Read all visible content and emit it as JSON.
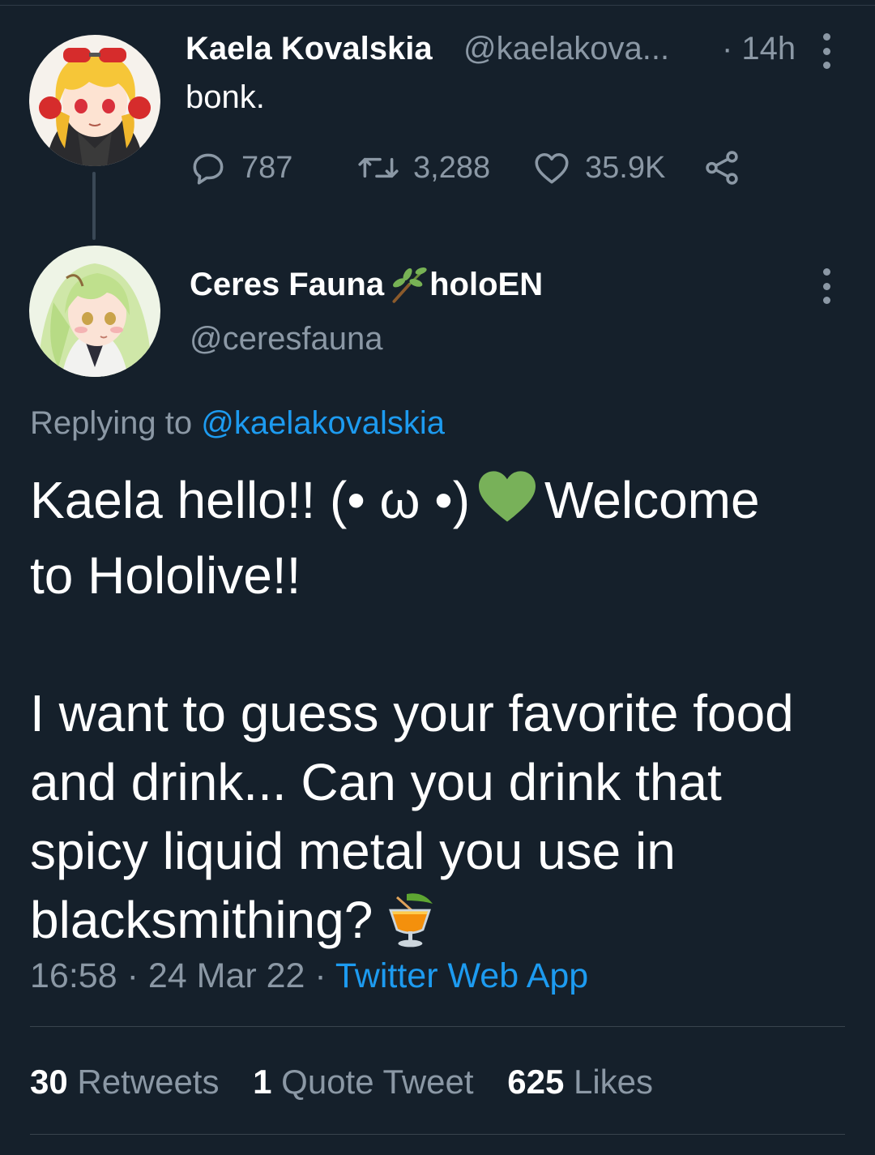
{
  "tweet1": {
    "display_name": "Kaela Kovalskia",
    "handle": "@kaelakova...",
    "time": "· 14h",
    "text": "bonk.",
    "replies": "787",
    "retweets": "3,288",
    "likes": "35.9K"
  },
  "tweet2": {
    "display_name_part1": "Ceres Fauna",
    "display_name_part2": "holoEN",
    "handle": "@ceresfauna",
    "replying_prefix": "Replying to",
    "replying_handle": "@kaelakovalskia",
    "text_line1_a": "Kaela hello!! (• ω •)",
    "text_line1_b": "Welcome",
    "text_line2": "to Hololive!!",
    "text_para2_line1": "I want to guess your favorite food",
    "text_para2_line2": "and drink... Can you drink that",
    "text_para2_line3": "spicy liquid metal you use in",
    "text_para2_line4": "blacksmithing?",
    "time": "16:58",
    "date": "24 Mar 22",
    "source": "Twitter Web App",
    "retweets_count": "30",
    "retweets_label": "Retweets",
    "quotes_count": "1",
    "quotes_label": "Quote Tweet",
    "likes_count": "625",
    "likes_label": "Likes"
  },
  "icons": {
    "reply": "reply-icon",
    "retweet": "retweet-icon",
    "like": "heart-icon",
    "share": "share-icon",
    "more": "more-icon",
    "name_emoji": "herb-icon",
    "heart_emoji": "green-heart-emoji",
    "drink_emoji": "tropical-drink-emoji"
  },
  "colors": {
    "background": "#15202b",
    "muted": "#8b98a5",
    "link": "#1d9bf0",
    "heart_emoji": "#78b159"
  }
}
